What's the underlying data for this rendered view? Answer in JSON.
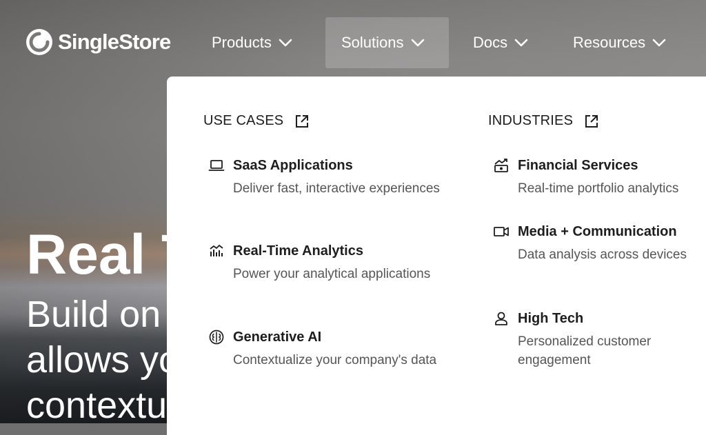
{
  "brand": {
    "name": "SingleStore"
  },
  "nav": {
    "items": [
      {
        "label": "Products"
      },
      {
        "label": "Solutions"
      },
      {
        "label": "Docs"
      },
      {
        "label": "Resources"
      }
    ],
    "active": "Solutions"
  },
  "hero": {
    "title": "Real T",
    "sub_line1": "Build on",
    "sub_line2": "allows yo",
    "sub_line3": "contextu"
  },
  "dropdown": {
    "use_cases": {
      "heading": "USE CASES",
      "items": [
        {
          "title": "SaaS Applications",
          "desc": "Deliver fast, interactive experiences",
          "icon": "laptop-icon"
        },
        {
          "title": "Real-Time Analytics",
          "desc": "Power your analytical applications",
          "icon": "analytics-chart-icon"
        },
        {
          "title": "Generative AI",
          "desc": "Contextualize your company's data",
          "icon": "brain-icon"
        }
      ]
    },
    "industries": {
      "heading": "INDUSTRIES",
      "items": [
        {
          "title": "Financial Services",
          "desc": "Real-time portfolio analytics",
          "icon": "finance-chart-icon"
        },
        {
          "title": "Media + Communication",
          "desc": "Data analysis across devices",
          "icon": "video-camera-icon"
        },
        {
          "title": "High Tech",
          "desc": "Personalized customer engagement",
          "icon": "person-icon"
        }
      ]
    }
  },
  "colors": {
    "dropdown_bg": "#ffffff",
    "text_dark": "#1d1d1d",
    "text_muted": "#555555",
    "nav_text": "#ffffff"
  }
}
